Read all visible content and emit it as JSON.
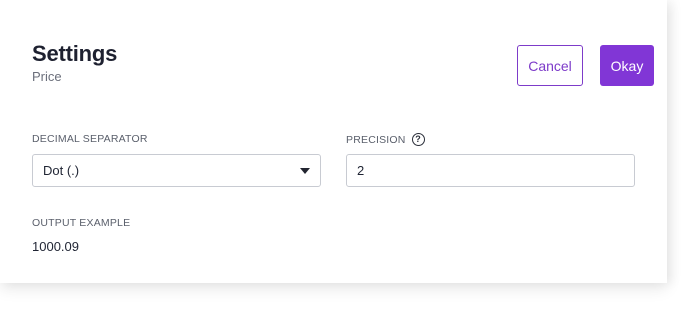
{
  "header": {
    "title": "Settings",
    "subtitle": "Price"
  },
  "actions": {
    "cancel_label": "Cancel",
    "okay_label": "Okay"
  },
  "decimal_separator": {
    "label": "DECIMAL SEPARATOR",
    "selected": "Dot (.)",
    "icon": "caret-down-icon"
  },
  "precision": {
    "label": "PRECISION",
    "help_icon": "question-circle-icon",
    "help_glyph": "?",
    "value": "2"
  },
  "output_example": {
    "label": "OUTPUT EXAMPLE",
    "value": "1000.09"
  },
  "colors": {
    "accent": "#8136d6",
    "border": "#c8cbd2",
    "text": "#1f2433"
  }
}
